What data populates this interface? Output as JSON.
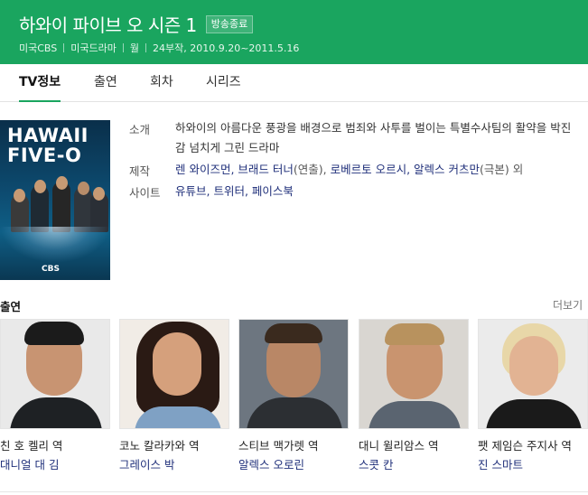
{
  "header": {
    "title": "하와이 파이브 오 시즌 1",
    "badge": "방송종료",
    "meta": [
      "미국CBS",
      "미국드라마",
      "월",
      "24부작, 2010.9.20~2011.5.16"
    ],
    "bg_color": "#1aa55f"
  },
  "tabs": [
    {
      "label": "TV정보",
      "active": true
    },
    {
      "label": "출연",
      "active": false
    },
    {
      "label": "회차",
      "active": false
    },
    {
      "label": "시리즈",
      "active": false
    }
  ],
  "poster": {
    "logo_line1": "HAWAII",
    "logo_line2": "FIVE-O",
    "network": "CBS"
  },
  "info": {
    "synopsis_label": "소개",
    "synopsis": "하와이의 아름다운 풍광을 배경으로 범죄와 사투를 벌이는 특별수사팀의 활약을 박진감 넘치게 그린 드라마",
    "production_label": "제작",
    "production": {
      "directors": "렌 와이즈먼, 브래드 터너",
      "directors_role": "(연출)",
      "writers": "로베르토 오르시, 알렉스 커츠만",
      "writers_role": "(극본)",
      "suffix": " 외"
    },
    "sites_label": "사이트",
    "sites": "유튜브, 트위터, 페이스북"
  },
  "cast": {
    "title": "출연",
    "more": "더보기",
    "members": [
      {
        "role": "친 호 켈리 역",
        "actor": "대니얼 대 김"
      },
      {
        "role": "코노 칼라카와 역",
        "actor": "그레이스 박"
      },
      {
        "role": "스티브 맥가렛 역",
        "actor": "알렉스 오로린"
      },
      {
        "role": "대니 윌리암스 역",
        "actor": "스콧 칸"
      },
      {
        "role": "팻 제임슨 주지사 역",
        "actor": "진 스마트"
      }
    ]
  }
}
